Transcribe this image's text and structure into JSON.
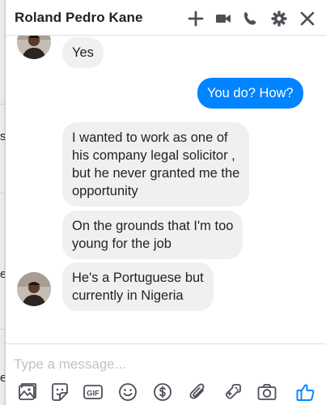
{
  "chat": {
    "title": "Roland Pedro Kane",
    "header_icons": [
      "plus-icon",
      "video-camera-icon",
      "phone-icon",
      "gear-icon",
      "close-icon"
    ],
    "accent_color": "#0084ff"
  },
  "messages": [
    {
      "direction": "incoming",
      "text": "Yes"
    },
    {
      "direction": "outgoing",
      "text": "You do? How?"
    },
    {
      "direction": "incoming",
      "text": "I wanted to work as one of\nhis company legal solicitor ,\nbut he never granted me the\nopportunity"
    },
    {
      "direction": "incoming",
      "text": "On the grounds that I'm too\nyoung for the job"
    },
    {
      "direction": "incoming",
      "text": "He's a Portuguese but\ncurrently in Nigeria"
    }
  ],
  "composer": {
    "placeholder": "Type a message...",
    "value": "",
    "tools": [
      "image-icon",
      "sticker-icon",
      "gif-icon",
      "emoji-icon",
      "payment-icon",
      "attachment-icon",
      "game-controller-icon",
      "camera-icon",
      "thumbs-up-icon"
    ],
    "gif_label": "GIF"
  }
}
